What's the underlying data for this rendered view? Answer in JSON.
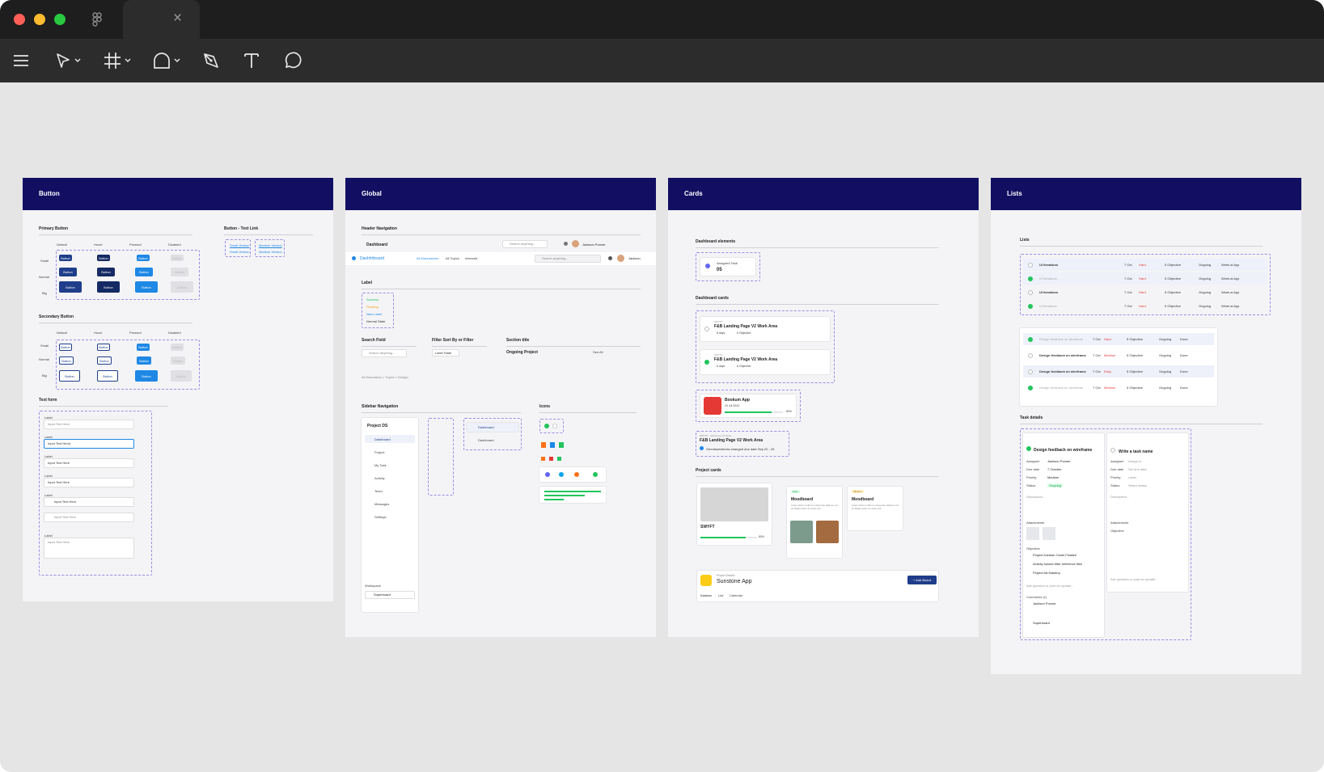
{
  "window": {
    "close_glyph": "×"
  },
  "colors": {
    "close": "#ff5f57",
    "minimize": "#febc2e",
    "maximize": "#28c840",
    "frame_header": "#120f63",
    "canvas": "#e5e5e5",
    "primary": "#1f3d8a",
    "accent": "#1e88e5",
    "success": "#22c55e",
    "danger": "#e53935"
  },
  "toolbar": {
    "icons": [
      "menu-icon",
      "move-icon",
      "frame-icon",
      "shape-icon",
      "pen-icon",
      "text-icon",
      "comment-icon"
    ]
  },
  "button_frame": {
    "title": "Button",
    "primary_label": "Primary Button",
    "secondary_label": "Secondary Button",
    "text_link_label": "Button - Text Link",
    "text_form_label": "Text form",
    "states": [
      "Default",
      "Hover",
      "Pressed",
      "Disabled"
    ],
    "sizes": [
      "Small",
      "Normal",
      "Big"
    ],
    "button_text": "Button",
    "links": [
      "Small Version",
      "Small Version",
      "Medium Version",
      "Medium Version"
    ],
    "form_label": "Label",
    "form_values": [
      "Input Text Here",
      "Input Text Here|",
      "Input Text Here",
      "Input Text Here",
      "Input Text Here",
      "Input Text Here",
      "Input Text Here"
    ]
  },
  "global_frame": {
    "title": "Global",
    "header_nav_label": "Header Navigation",
    "dashboard": "Dashboard",
    "search_placeholder": "Search anything...",
    "user_name": "Jackson Ponner",
    "brand": "Dashhhboard",
    "nav_tabs": [
      "All Discussions",
      "All Topics",
      "Internals"
    ],
    "user_short": "Jackson",
    "label_section": "Label",
    "labels": [
      "Success",
      "Pending",
      "New Label",
      "Normal State"
    ],
    "search_field": "Search Field",
    "filter_sort": "Filter Sort By or Filter",
    "section_title": "Section title",
    "ongoing_project": "Ongoing Project",
    "see_all": "See All",
    "select_state": "Label State",
    "breadcrumb": "All Discussion  >  Topics  >  Design",
    "sidebar_nav": "Sidebar Navigation",
    "icons_label": "Icons",
    "project": "Project DS",
    "menu": [
      "Dashboard",
      "Project",
      "My Task",
      "Activity",
      "Team",
      "Messages",
      "Settings"
    ],
    "workspace": "Workspace",
    "workspace_item": "Superboard",
    "dashboard_item": "Dashboard"
  },
  "cards_frame": {
    "title": "Cards",
    "dashboard_elements": "Dashboard elements",
    "assigned_task": "Assigned Task",
    "assigned_count": "05",
    "dashboard_cards": "Dashboard cards",
    "card_small": "SWYFT",
    "card_task": "F&B Landing Page V2 Work Area",
    "card_meta": [
      "8 days",
      "6 Objective"
    ],
    "bookum": "Bookum App",
    "bookum_date": "24 Jul 2024",
    "bookum_pct": "80%",
    "activity_sub": "SWYFT · Activity by UX Zone",
    "activity_title": "F&B Landing Page V2 Work Area",
    "activity_note": "Ommisweetness changed due date Sep 20 - 25",
    "project_cards": "Project cards",
    "swyft": "SWYFT",
    "swyft_pct": "80%",
    "moodboard": "Moodboard",
    "tag_easy": "Easy",
    "tag_medium": "Medium",
    "lorem": "Amet minim mollit non deserunt ullamco est sit aliqua dolor do amet sint.",
    "project_details": "Project Details",
    "sunstone": "Sunstone App",
    "add_board": "+ Add Board",
    "board_tabs": [
      "Kanban",
      "List",
      "Calendar"
    ]
  },
  "lists_frame": {
    "title": "Lists",
    "lists_label": "Lists",
    "ui_rows": [
      "UI Iterations",
      "UI Iterations",
      "UI Iterations",
      "UI Iterations"
    ],
    "row_date": "7 Oct",
    "row_priority": "Hard",
    "row_objective": "5 Objective",
    "row_status": "Ongoing",
    "row_project": "Week.ai App",
    "design_rows": [
      "Design feedback on wireframe",
      "Design feedback on wireframe",
      "Design feedback on wireframe",
      "Design feedback on wireframe"
    ],
    "priorities": [
      "Hard",
      "Medium",
      "Easy",
      "Medium"
    ],
    "row_done": "Done",
    "task_details": "Task details",
    "task_title": "Design feedback on wireframe",
    "task_new": "Write a task name",
    "field_names": [
      "Assignee",
      "Due date",
      "Priority",
      "Status"
    ],
    "field_values": [
      "Jackson Ponner",
      "7 October",
      "Medium",
      "Ongoing"
    ],
    "new_values": [
      "Assign to",
      "Set due date",
      "Label",
      "Select status"
    ],
    "description": "Description...",
    "attachments": "Attachments",
    "objective": "Objective",
    "objectives": [
      "Project Kanban Cards Finalize",
      "Activity tracker filter reference files",
      "Project list Mastery"
    ],
    "comment_hint": "Ask question or post an update...",
    "comments": "Comments (1)",
    "commenter_1": "Jackson Ponner",
    "commenter_2": "Superboard"
  }
}
